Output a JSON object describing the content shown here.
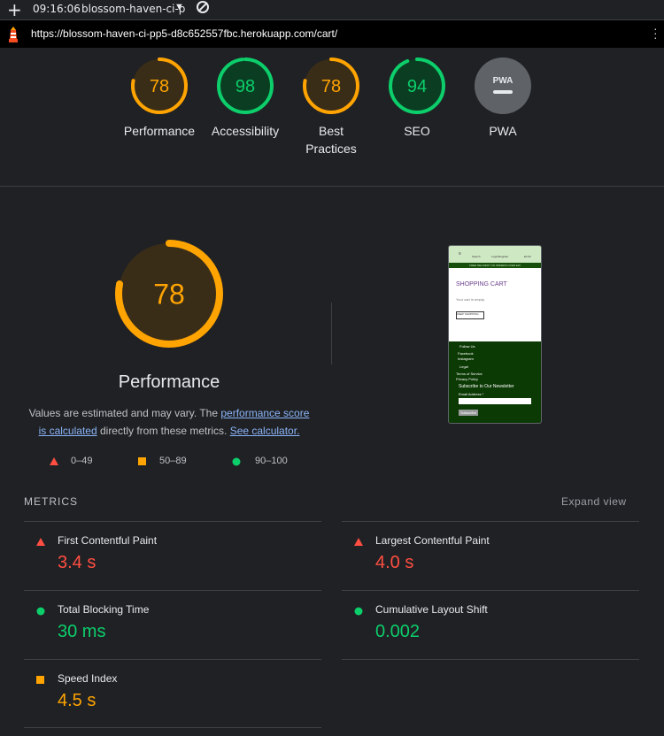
{
  "window": {
    "time": "09:16:06",
    "tab_title": "blossom-haven-ci-p",
    "url": "https://blossom-haven-ci-pp5-d8c652557fbc.herokuapp.com/cart/"
  },
  "gauges": [
    {
      "label": "Performance",
      "score": "78",
      "value": 78,
      "status": "orange"
    },
    {
      "label": "Accessibility",
      "score": "98",
      "value": 98,
      "status": "green"
    },
    {
      "label": "Best",
      "label2": "Practices",
      "score": "78",
      "value": 78,
      "status": "orange"
    },
    {
      "label": "SEO",
      "score": "94",
      "value": 94,
      "status": "green"
    },
    {
      "label": "PWA",
      "badge": "PWA",
      "status": "gray"
    }
  ],
  "main": {
    "score": "78",
    "value": 78,
    "title": "Performance",
    "note_prefix": "Values are estimated and may vary. The ",
    "note_link1": "performance score is calculated",
    "note_mid": " directly from these metrics. ",
    "note_link2": "See calculator."
  },
  "legend": [
    {
      "range": "0–49",
      "shape": "triangle",
      "color": "#ff4e42"
    },
    {
      "range": "50–89",
      "shape": "square",
      "color": "#ffa400"
    },
    {
      "range": "90–100",
      "shape": "circle",
      "color": "#0cce6b"
    }
  ],
  "thumbnail": {
    "nav": [
      "Search",
      "Login/Register",
      "£0.00"
    ],
    "banner": "FREE DELIVERY ON ORDERS OVER £20",
    "heading": "SHOPPING CART",
    "empty_text": "Your cart is empty.",
    "button": "KEEP SHOPPING",
    "follow": "Follow Us",
    "facebook": "Facebook",
    "instagram": "Instagram",
    "legal": "Legal",
    "terms": "Terms of Service",
    "privacy": "Privacy Policy",
    "newsletter": "Subscribe to Our Newsletter",
    "email_label": "Email Address *",
    "subscribe": "Subscribe"
  },
  "metrics_section": {
    "header": "METRICS",
    "expand": "Expand view"
  },
  "metrics": [
    {
      "name": "First Contentful Paint",
      "value": "3.4 s",
      "status": "red"
    },
    {
      "name": "Largest Contentful Paint",
      "value": "4.0 s",
      "status": "red"
    },
    {
      "name": "Total Blocking Time",
      "value": "30 ms",
      "status": "green"
    },
    {
      "name": "Cumulative Layout Shift",
      "value": "0.002",
      "status": "green"
    },
    {
      "name": "Speed Index",
      "value": "4.5 s",
      "status": "orange"
    }
  ],
  "colors": {
    "red": "#ff4e42",
    "orange": "#ffa400",
    "green": "#0cce6b",
    "link": "#8ab4f8",
    "background": "#202124"
  }
}
